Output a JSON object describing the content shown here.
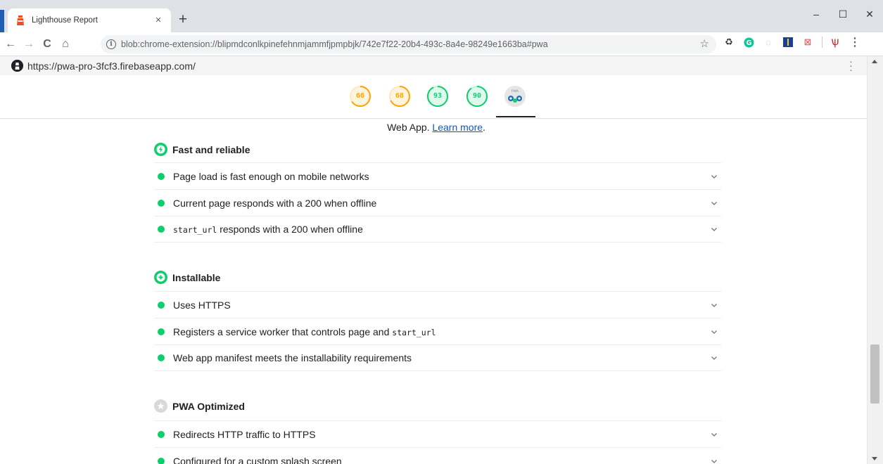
{
  "browser": {
    "tab_title": "Lighthouse Report",
    "tab_close": "×",
    "new_tab": "+",
    "window_controls": {
      "minimize": "–",
      "maximize": "☐",
      "close": "✕"
    },
    "address_url": "blob:chrome-extension://blipmdconlkpinefehnmjammfjpmpbjk/742e7f22-20b4-493c-8a4e-98249e1663ba#pwa",
    "nav": {
      "back": "←",
      "forward": "→",
      "reload": "C",
      "home": "⌂"
    },
    "menu_icon": "⋮"
  },
  "report": {
    "site_url": "https://pwa-pro-3fcf3.firebaseapp.com/",
    "gauges": [
      {
        "score": "66",
        "value": 66,
        "color": "#ffa400"
      },
      {
        "score": "68",
        "value": 68,
        "color": "#ffa400"
      },
      {
        "score": "93",
        "value": 93,
        "color": "#0cce6b"
      },
      {
        "score": "90",
        "value": 90,
        "color": "#0cce6b"
      }
    ],
    "pwa_badge_label": "PWA",
    "description_prefix": "Web App.",
    "learn_more": "Learn more",
    "description_suffix": ".",
    "groups": [
      {
        "title": "Fast and reliable",
        "audits": [
          {
            "text": "Page load is fast enough on mobile networks"
          },
          {
            "text": "Current page responds with a 200 when offline"
          },
          {
            "code": "start_url",
            "text": " responds with a 200 when offline"
          }
        ]
      },
      {
        "title": "Installable",
        "audits": [
          {
            "text": "Uses HTTPS"
          },
          {
            "text": "Registers a service worker that controls page and ",
            "code_after": "start_url"
          },
          {
            "text": "Web app manifest meets the installability requirements"
          }
        ]
      },
      {
        "title": "PWA Optimized",
        "audits": [
          {
            "text": "Redirects HTTP traffic to HTTPS"
          },
          {
            "text": "Configured for a custom splash screen"
          }
        ]
      }
    ]
  },
  "colors": {
    "pass": "#0cce6b",
    "average": "#ffa400",
    "link": "#0b57d0"
  }
}
